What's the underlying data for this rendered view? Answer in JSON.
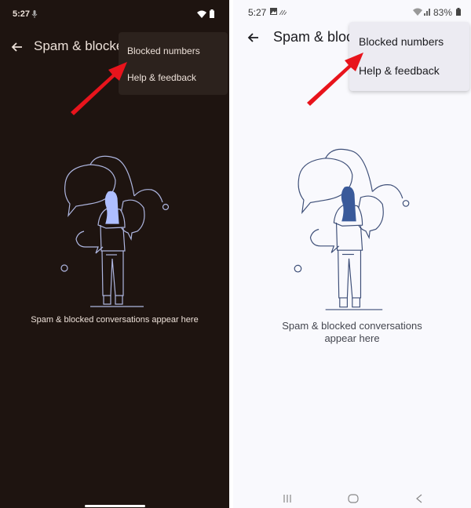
{
  "left_screen": {
    "status_bar": {
      "time": "5:27"
    },
    "appbar": {
      "title": "Spam & blocked"
    },
    "overflow_menu": {
      "items": [
        {
          "label": "Blocked numbers"
        },
        {
          "label": "Help & feedback"
        }
      ]
    },
    "empty_state": {
      "message": "Spam & blocked conversations appear here"
    },
    "colors": {
      "background": "#1e1410",
      "illustration_accent": "#aebeff"
    }
  },
  "right_screen": {
    "status_bar": {
      "time": "5:27",
      "battery": "83%"
    },
    "appbar": {
      "title": "Spam & blocked"
    },
    "overflow_menu": {
      "items": [
        {
          "label": "Blocked numbers"
        },
        {
          "label": "Help & feedback"
        }
      ]
    },
    "empty_state": {
      "line1": "Spam & blocked conversations",
      "line2": "appear here"
    },
    "nav_bar": {
      "buttons": [
        "recent-apps",
        "home",
        "back"
      ]
    },
    "colors": {
      "background": "#f9f9fd",
      "illustration_accent": "#3a5a9a"
    }
  },
  "annotation": {
    "arrow_color": "#e8141c"
  }
}
